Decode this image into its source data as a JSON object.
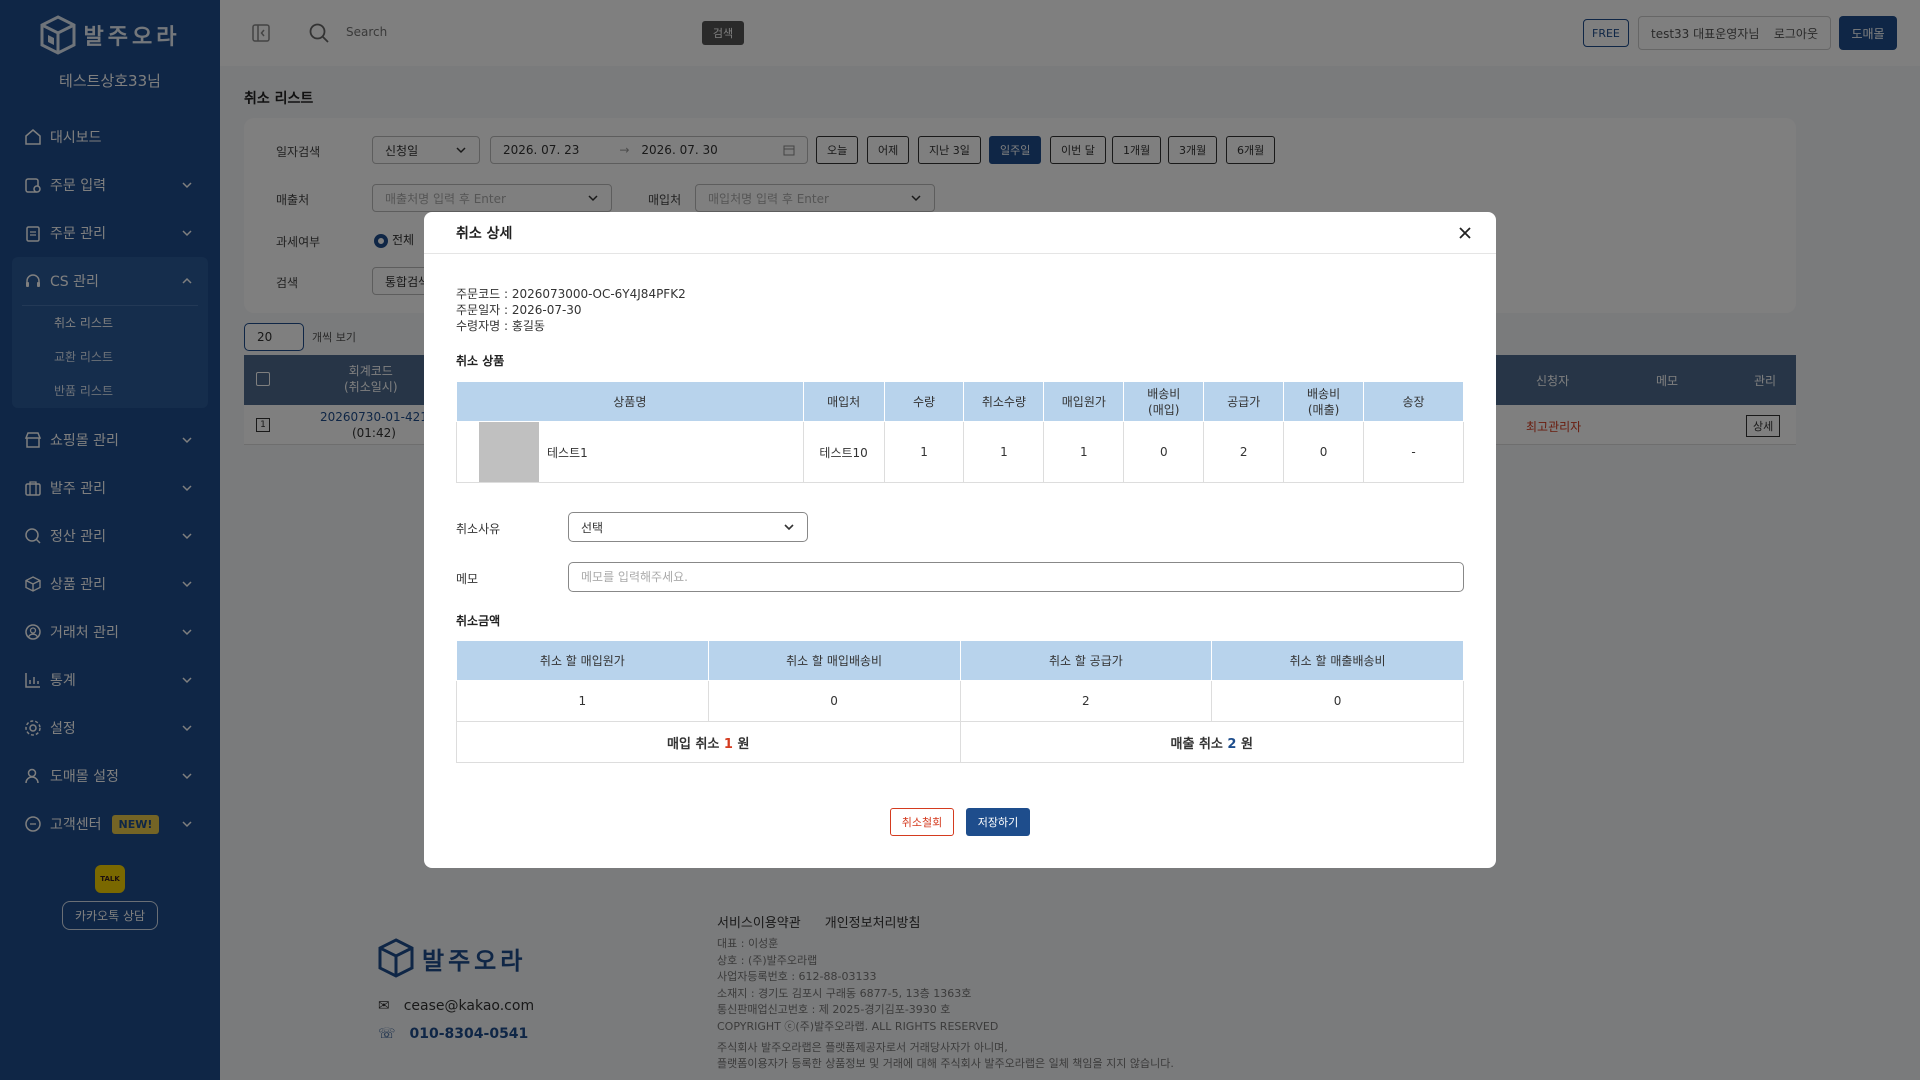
{
  "brand": {
    "logo_text": "발주오라",
    "shop_name": "테스트상호33님"
  },
  "sidebar": {
    "items": [
      {
        "label": "대시보드",
        "icon": "home-icon"
      },
      {
        "label": "주문 입력",
        "icon": "order-input-icon"
      },
      {
        "label": "주문 관리",
        "icon": "clipboard-icon"
      },
      {
        "label": "CS 관리",
        "icon": "headset-icon"
      },
      {
        "label": "쇼핑몰 관리",
        "icon": "store-icon"
      },
      {
        "label": "발주 관리",
        "icon": "briefcase-icon"
      },
      {
        "label": "정산 관리",
        "icon": "settlement-icon"
      },
      {
        "label": "상품 관리",
        "icon": "box-icon"
      },
      {
        "label": "거래처 관리",
        "icon": "user-circle-icon"
      },
      {
        "label": "통계",
        "icon": "chart-icon"
      },
      {
        "label": "설정",
        "icon": "gear-icon"
      },
      {
        "label": "도매몰 설정",
        "icon": "user-icon"
      },
      {
        "label": "고객센터",
        "icon": "chat-icon"
      }
    ],
    "cs_sub": [
      "취소 리스트",
      "교환 리스트",
      "반품 리스트"
    ],
    "new_badge": "NEW!",
    "kakao_icon_text": "TALK",
    "kakao_button": "카카오톡 상담"
  },
  "topbar": {
    "search_placeholder": "Search",
    "search_button": "검색",
    "plan": "FREE",
    "user": "test33 대표운영자님",
    "logout": "로그아웃",
    "wholesale": "도매몰"
  },
  "page": {
    "title": "취소 리스트",
    "filters": {
      "date_label": "일자검색",
      "date_type": "신청일",
      "date_from": "2026. 07. 23",
      "date_arrow": "→",
      "date_to": "2026. 07. 30",
      "quick_buttons": [
        "오늘",
        "어제",
        "지난 3일",
        "일주일",
        "이번 달",
        "1개월",
        "3개월",
        "6개월"
      ],
      "active_quick": "일주일",
      "sales_label": "매출처",
      "sales_placeholder": "매출처명 입력 후 Enter",
      "purchase_label": "매입처",
      "purchase_placeholder": "매입처명 입력 후 Enter",
      "tax_label": "과세여부",
      "tax_all": "전체",
      "search_label": "검색",
      "search_type": "통합검색"
    },
    "per_page": "20",
    "per_page_label": "개씩 보기",
    "table": {
      "headers": {
        "code": "회계코드",
        "code_sub": "(취소일시)",
        "applicant": "신청자",
        "memo": "메모",
        "manage": "관리"
      },
      "row": {
        "checkbox": "1",
        "code": "20260730-01-421",
        "time": "(01:42)",
        "applicant": "최고관리자",
        "detail": "상세"
      }
    }
  },
  "modal": {
    "title": "취소 상세",
    "order_code": "주문코드 : 2026073000-OC-6Y4J84PFK2",
    "order_date": "주문일자 : 2026-07-30",
    "receiver": "수령자명 : 홍길동",
    "products_title": "취소 상품",
    "product_headers": [
      "상품명",
      "매입처",
      "수량",
      "취소수량",
      "매입원가",
      "배송비\n(매입)",
      "공급가",
      "배송비\n(매출)",
      "송장"
    ],
    "product_row": {
      "name": "테스트1",
      "supplier": "테스트10",
      "qty": "1",
      "cancel_qty": "1",
      "cost": "1",
      "ship_buy": "0",
      "supply": "2",
      "ship_sell": "0",
      "invoice": "-"
    },
    "reason_label": "취소사유",
    "reason_value": "선택",
    "memo_label": "메모",
    "memo_placeholder": "메모를 입력해주세요.",
    "amount_title": "취소금액",
    "amount_headers": [
      "취소 할 매입원가",
      "취소 할 매입배송비",
      "취소 할 공급가",
      "취소 할 매출배송비"
    ],
    "amount_values": [
      "1",
      "0",
      "2",
      "0"
    ],
    "purchase_total": {
      "prefix": "매입 취소 ",
      "value": "1",
      "suffix": " 원"
    },
    "sales_total": {
      "prefix": "매출 취소 ",
      "value": "2",
      "suffix": " 원"
    },
    "btn_withdraw": "취소철회",
    "btn_save": "저장하기"
  },
  "footer": {
    "terms": "서비스이용약관",
    "privacy": "개인정보처리방침",
    "email": "cease@kakao.com",
    "phone": "010-8304-0541",
    "info": [
      "대표 : 이성훈",
      "상호 : (주)발주오라랩",
      "사업자등록번호 : 612-88-03133",
      "소재지 : 경기도 김포시 구래동 6877-5, 13층 1363호",
      "통신판매업신고번호 : 제 2025-경기김포-3930 호",
      "COPYRIGHT ⓒ(주)발주오라랩. ALL RIGHTS RESERVED"
    ],
    "note": [
      "주식회사 발주오라랩은 플랫폼제공자로서 거래당사자가 아니며,",
      "플랫폼이용자가 등록한 상품정보 및 거래에 대해 주식회사 발주오라랩은 일체 책임을 지지 않습니다."
    ]
  },
  "colors": {
    "brand": "#1e4d8c",
    "header_cell": "#b8d3ec",
    "danger": "#d43b1f",
    "kakao": "#f5d100"
  }
}
